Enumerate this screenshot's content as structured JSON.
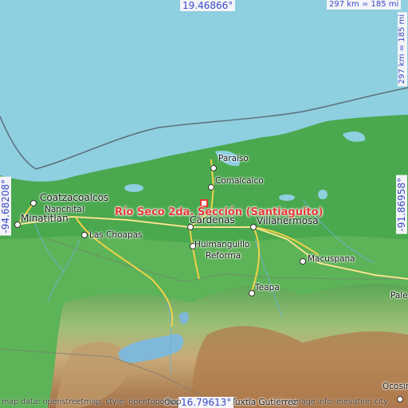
{
  "coords": {
    "top": "19.46866°",
    "bottom": "16.79613°",
    "left": "-94.68208°",
    "right": "-91.86958°"
  },
  "scale": {
    "horizontal": "297 km = 185 mi",
    "vertical": "297 km = 185 mi"
  },
  "target": {
    "label": "Río Seco 2da. Sección (Santiaguito)",
    "color": "#e53935"
  },
  "cities": {
    "coatzacoalcos": "Coatzacoalcos",
    "nanchital": "Nanchital",
    "minatitlan": "Minatitlán",
    "las_choapas": "Las Choapas",
    "paraiso": "Paraíso",
    "comalcalco": "Comalcalco",
    "cardenas": "Cárdenas",
    "villahermosa": "Villahermosa",
    "huimanguillo": "Huimanguillo",
    "reforma": "Reforma",
    "macuspana": "Macuspana",
    "teapa": "Teapa",
    "ocosingo": "Ocosing",
    "tuxtla": "Tuxtla Gutiérrez",
    "palenque": "Pale",
    "oco_bottom": "Oco"
  },
  "credits": {
    "left": "map data: openstreetmap, style: opentopomap",
    "right": "image info: elevation.city"
  },
  "colors": {
    "sea": "#8ecfe0",
    "lowland": "#3d9c48",
    "plain": "#63b85a",
    "hills": "#c9b98a",
    "mountains": "#a97b52"
  }
}
